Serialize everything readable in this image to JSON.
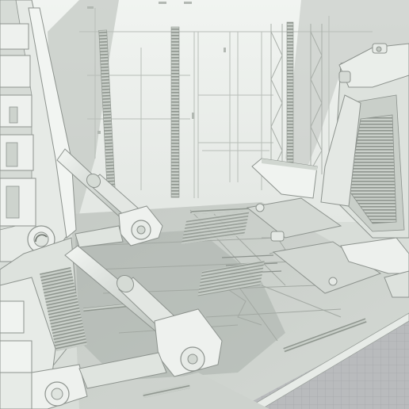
{
  "scene": {
    "colors": {
      "background_wall": "#eef1ee",
      "wall_shadow": "#aeb4af",
      "floor": "#c7ccc7",
      "floor_shadow": "#9da39e",
      "panel_light": "#e9ede9",
      "panel_mid": "#d2d8d2",
      "panel_dark": "#a7aea8",
      "grid_bg": "#b9bbbd",
      "grid_line": "#a5a8ab",
      "line": "#8d938e"
    }
  }
}
